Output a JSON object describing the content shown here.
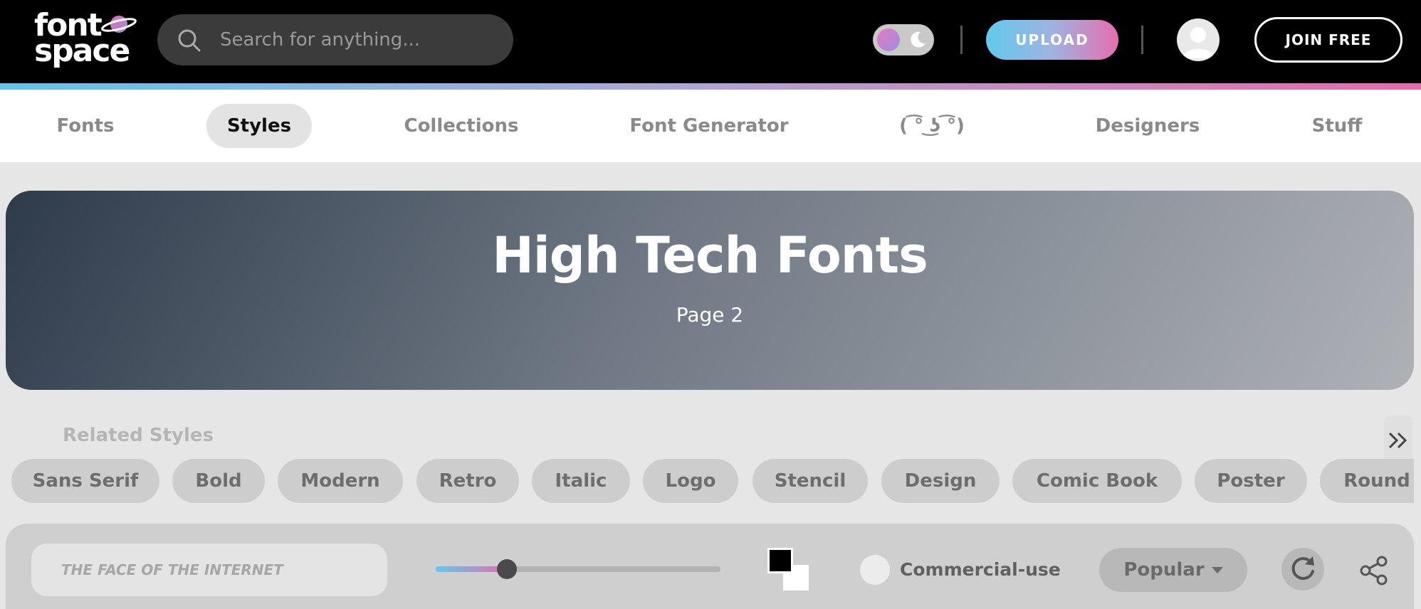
{
  "header": {
    "logo": {
      "line1": "font",
      "line2": "space"
    },
    "search": {
      "placeholder": "Search for anything...",
      "icon": "search-icon"
    },
    "theme_toggle": {
      "icon": "moon-icon"
    },
    "upload_label": "UPLOAD",
    "avatar_icon": "user-icon",
    "join_label": "JOIN FREE"
  },
  "nav": {
    "items": [
      {
        "label": "Fonts",
        "active": false
      },
      {
        "label": "Styles",
        "active": true
      },
      {
        "label": "Collections",
        "active": false
      },
      {
        "label": "Font Generator",
        "active": false
      },
      {
        "label": "( ͡° ͜ʖ ͡°)",
        "active": false
      },
      {
        "label": "Designers",
        "active": false
      },
      {
        "label": "Stuff",
        "active": false
      }
    ]
  },
  "hero": {
    "title": "High Tech Fonts",
    "subtitle": "Page 2"
  },
  "related": {
    "label": "Related Styles",
    "scroll_icon": "double-chevron-right-icon",
    "chips": [
      "Sans Serif",
      "Bold",
      "Modern",
      "Retro",
      "Italic",
      "Logo",
      "Stencil",
      "Design",
      "Comic Book",
      "Poster",
      "Round"
    ]
  },
  "toolbar": {
    "preview_placeholder": "THE FACE OF THE INTERNET",
    "font_size_slider": 0.25,
    "colors": {
      "foreground": "#000000",
      "background": "#ffffff"
    },
    "commercial_label": "Commercial-use",
    "sort_label": "Popular",
    "refresh_icon": "refresh-icon",
    "share_icon": "share-icon"
  },
  "colors": {
    "accent_gradient": [
      "#62c9ee",
      "#e66db0"
    ],
    "hero_gradient": [
      "#2e3b4b",
      "#aeb1b6"
    ]
  }
}
